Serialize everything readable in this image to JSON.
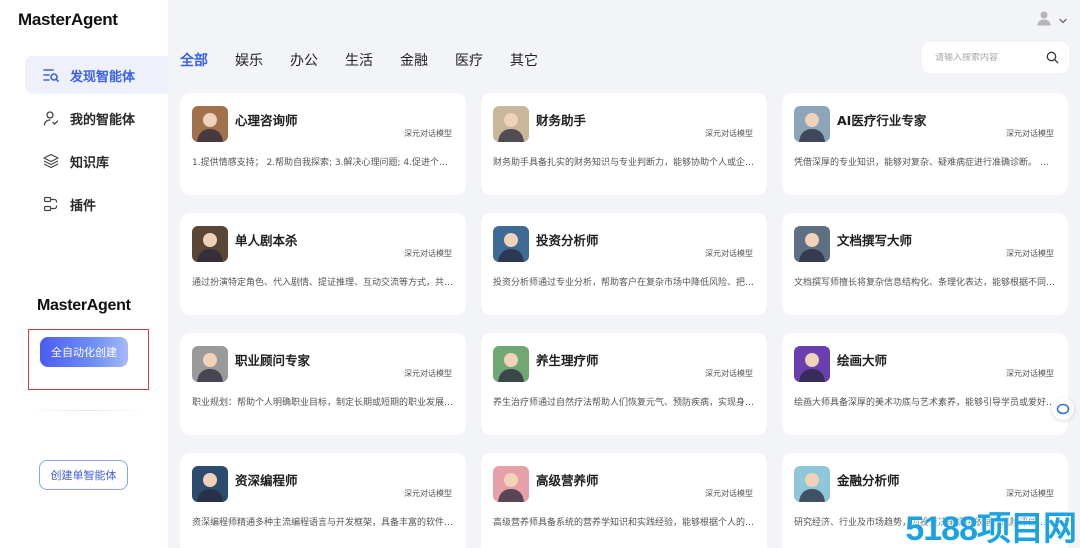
{
  "sidebar": {
    "logo": "MasterAgent",
    "nav": [
      {
        "label": "发现智能体",
        "icon": "discover-icon",
        "active": true
      },
      {
        "label": "我的智能体",
        "icon": "user-agent-icon",
        "active": false
      },
      {
        "label": "知识库",
        "icon": "layers-icon",
        "active": false
      },
      {
        "label": "插件",
        "icon": "plugin-icon",
        "active": false
      }
    ],
    "logo2": "MasterAgent",
    "auto_create_label": "全自动化创建",
    "create_single_label": "创建单智能体"
  },
  "tabs": [
    {
      "label": "全部",
      "active": true
    },
    {
      "label": "娱乐",
      "active": false
    },
    {
      "label": "办公",
      "active": false
    },
    {
      "label": "生活",
      "active": false
    },
    {
      "label": "金融",
      "active": false
    },
    {
      "label": "医疗",
      "active": false
    },
    {
      "label": "其它",
      "active": false
    }
  ],
  "search": {
    "placeholder": "请输入搜索内容"
  },
  "cards": [
    {
      "title": "心理咨询师",
      "tag": "深元对话模型",
      "desc": "1.提供情感支持； 2.帮助自我探索; 3.解决心理问题; 4.促进个人…",
      "avatar_color": "#a0714a"
    },
    {
      "title": "财务助手",
      "tag": "深元对话模型",
      "desc": "财务助手具备扎实的财务知识与专业判断力，能够协助个人或企…",
      "avatar_color": "#c9b79c"
    },
    {
      "title": "AI医疗行业专家",
      "tag": "深元对话模型",
      "desc": "凭借深厚的专业知识，能够对复杂、疑难病症进行准确诊断。 为…",
      "avatar_color": "#8aa6b8"
    },
    {
      "title": "单人剧本杀",
      "tag": "深元对话模型",
      "desc": "通过扮演特定角色、代入剧情、提证推理、互动交流等方式，共…",
      "avatar_color": "#5a4636"
    },
    {
      "title": "投资分析师",
      "tag": "深元对话模型",
      "desc": "投资分析师通过专业分析，帮助客户在复杂市场中降低风险、把…",
      "avatar_color": "#3e6a96"
    },
    {
      "title": "文档撰写大师",
      "tag": "深元对话模型",
      "desc": "文档撰写师擅长将复杂信息结构化、条理化表达，能够根据不同…",
      "avatar_color": "#5d6f82"
    },
    {
      "title": "职业顾问专家",
      "tag": "深元对话模型",
      "desc": "职业规划：帮助个人明确职业目标，制定长期或短期的职业发展…",
      "avatar_color": "#9a9a9a"
    },
    {
      "title": "养生理疗师",
      "tag": "深元对话模型",
      "desc": "养生治疗师通过自然疗法帮助人们恢复元气、预防疾病，实现身…",
      "avatar_color": "#6fa874"
    },
    {
      "title": "绘画大师",
      "tag": "深元对话模型",
      "desc": "绘画大师具备深厚的美术功底与艺术素养，能够引导学员或爱好…",
      "avatar_color": "#6a3fb0"
    },
    {
      "title": "资深编程师",
      "tag": "深元对话模型",
      "desc": "资深编程师精通多种主流编程语言与开发框架，具备丰富的软件…",
      "avatar_color": "#2c4c6e"
    },
    {
      "title": "高级营养师",
      "tag": "深元对话模型",
      "desc": "高级营养师具备系统的营养学知识和实践经验，能够根据个人的…",
      "avatar_color": "#e7a0a8"
    },
    {
      "title": "金融分析师",
      "tag": "深元对话模型",
      "desc": "研究经济、行业及市场趋势，为投资决策提供依据。风险评估:…",
      "avatar_color": "#8fc7d8"
    }
  ],
  "watermark": "5188项目网",
  "colors": {
    "accent": "#3b62e6",
    "highlight_box": "#e03a3a"
  }
}
